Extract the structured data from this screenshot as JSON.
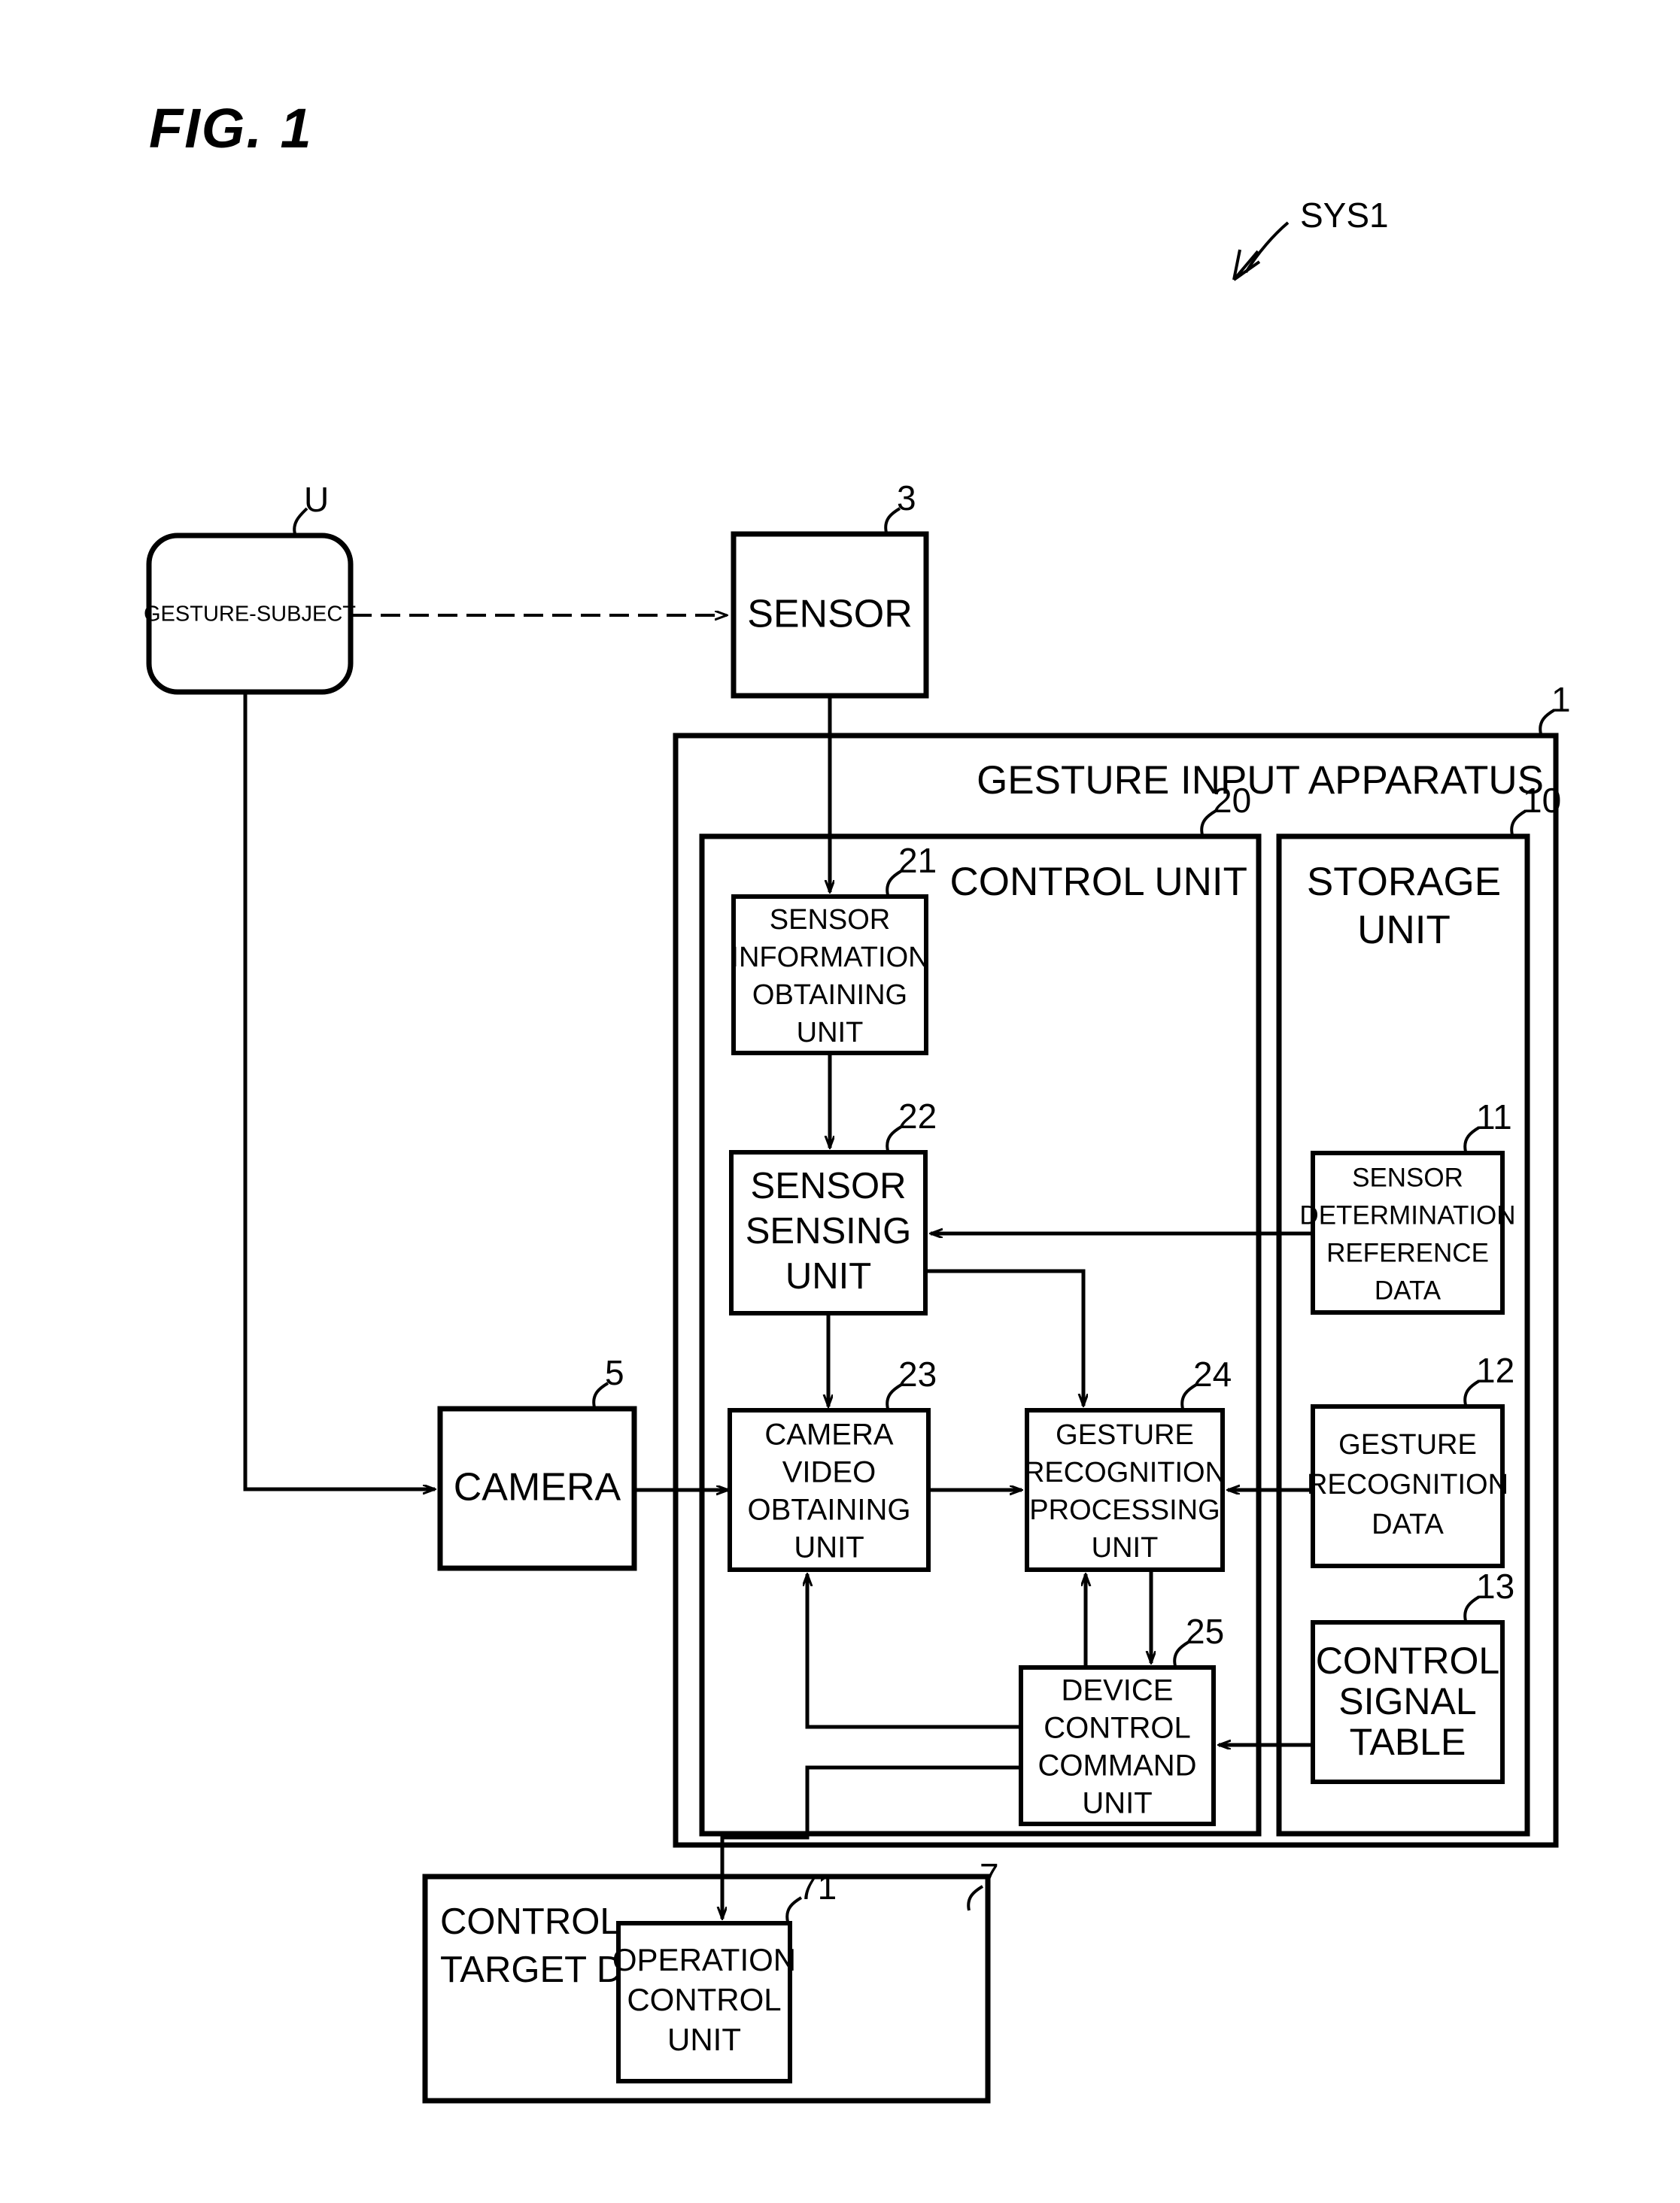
{
  "figure": {
    "title": "FIG. 1",
    "system_label": "SYS1"
  },
  "blocks": {
    "gesture_subject": {
      "label": "GESTURE-SUBJECT",
      "ref": "U"
    },
    "sensor": {
      "label": "SENSOR",
      "ref": "3"
    },
    "camera": {
      "label": "CAMERA",
      "ref": "5"
    },
    "apparatus": {
      "label": "GESTURE INPUT APPARATUS",
      "ref": "1"
    },
    "control_unit": {
      "label": "CONTROL UNIT",
      "ref": "20"
    },
    "storage_unit": {
      "label_line1": "STORAGE",
      "label_line2": "UNIT",
      "ref": "10"
    },
    "sensor_information_obtaining_unit": {
      "line1": "SENSOR",
      "line2": "INFORMATION",
      "line3": "OBTAINING",
      "line4": "UNIT",
      "ref": "21"
    },
    "sensor_sensing_unit": {
      "line1": "SENSOR",
      "line2": "SENSING",
      "line3": "UNIT",
      "ref": "22"
    },
    "camera_video_obtaining_unit": {
      "line1": "CAMERA",
      "line2": "VIDEO",
      "line3": "OBTAINING",
      "line4": "UNIT",
      "ref": "23"
    },
    "gesture_recognition_processing_unit": {
      "line1": "GESTURE",
      "line2": "RECOGNITION",
      "line3": "PROCESSING",
      "line4": "UNIT",
      "ref": "24"
    },
    "device_control_command_unit": {
      "line1": "DEVICE",
      "line2": "CONTROL",
      "line3": "COMMAND",
      "line4": "UNIT",
      "ref": "25"
    },
    "sensor_determination_reference_data": {
      "line1": "SENSOR",
      "line2": "DETERMINATION",
      "line3": "REFERENCE",
      "line4": "DATA",
      "ref": "11"
    },
    "gesture_recognition_data": {
      "line1": "GESTURE",
      "line2": "RECOGNITION",
      "line3": "DATA",
      "ref": "12"
    },
    "control_signal_table": {
      "line1": "CONTROL",
      "line2": "SIGNAL",
      "line3": "TABLE",
      "ref": "13"
    },
    "control_target_device": {
      "line1": "CONTROL",
      "line2": "TARGET DEVICE",
      "ref": "7"
    },
    "operation_control_unit": {
      "line1": "OPERATION",
      "line2": "CONTROL",
      "line3": "UNIT",
      "ref": "71"
    }
  },
  "colors": {
    "line": "#000000",
    "background": "#ffffff"
  }
}
